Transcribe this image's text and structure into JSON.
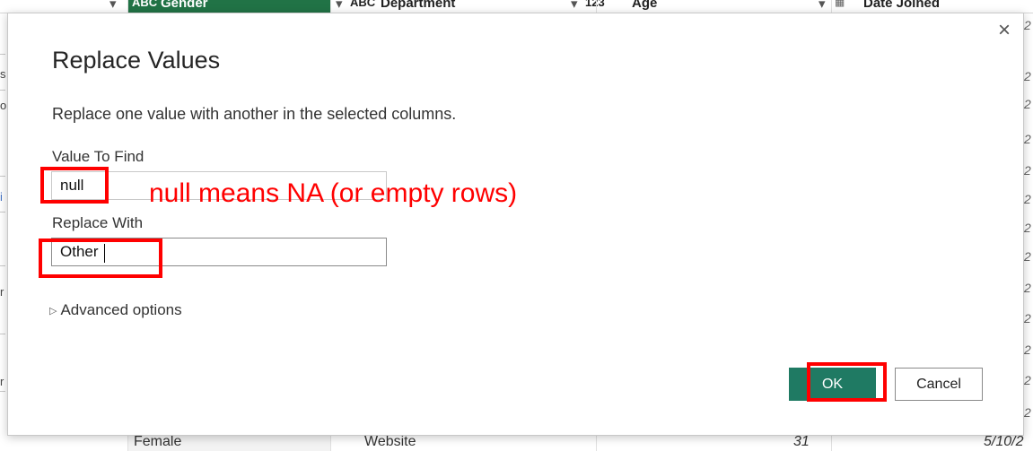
{
  "background_grid": {
    "columns": [
      {
        "type_icon": "ABC",
        "label": "Gender"
      },
      {
        "type_icon": "ABC",
        "label": "Department"
      },
      {
        "type_icon": "123",
        "label": "Age"
      },
      {
        "type_icon": "calendar",
        "label": "Date Joined"
      }
    ],
    "bottom_row": {
      "gender": "Female",
      "department": "Website",
      "age": "31",
      "date_joined": "5/10/2"
    },
    "left_edge_chars": [
      "s",
      "o",
      "i",
      "r",
      "r"
    ],
    "right_edge_char": "2"
  },
  "dialog": {
    "title": "Replace Values",
    "description": "Replace one value with another in the selected columns.",
    "value_to_find": {
      "label": "Value To Find",
      "value": "null"
    },
    "replace_with": {
      "label": "Replace With",
      "value": "Other"
    },
    "advanced_options": "Advanced options",
    "ok_label": "OK",
    "cancel_label": "Cancel",
    "close_glyph": "×"
  },
  "annotations": {
    "note": "null means NA (or empty rows)",
    "color": "#ff0000"
  },
  "colors": {
    "ok_button": "#1f7a63",
    "header_highlight": "#217346"
  }
}
